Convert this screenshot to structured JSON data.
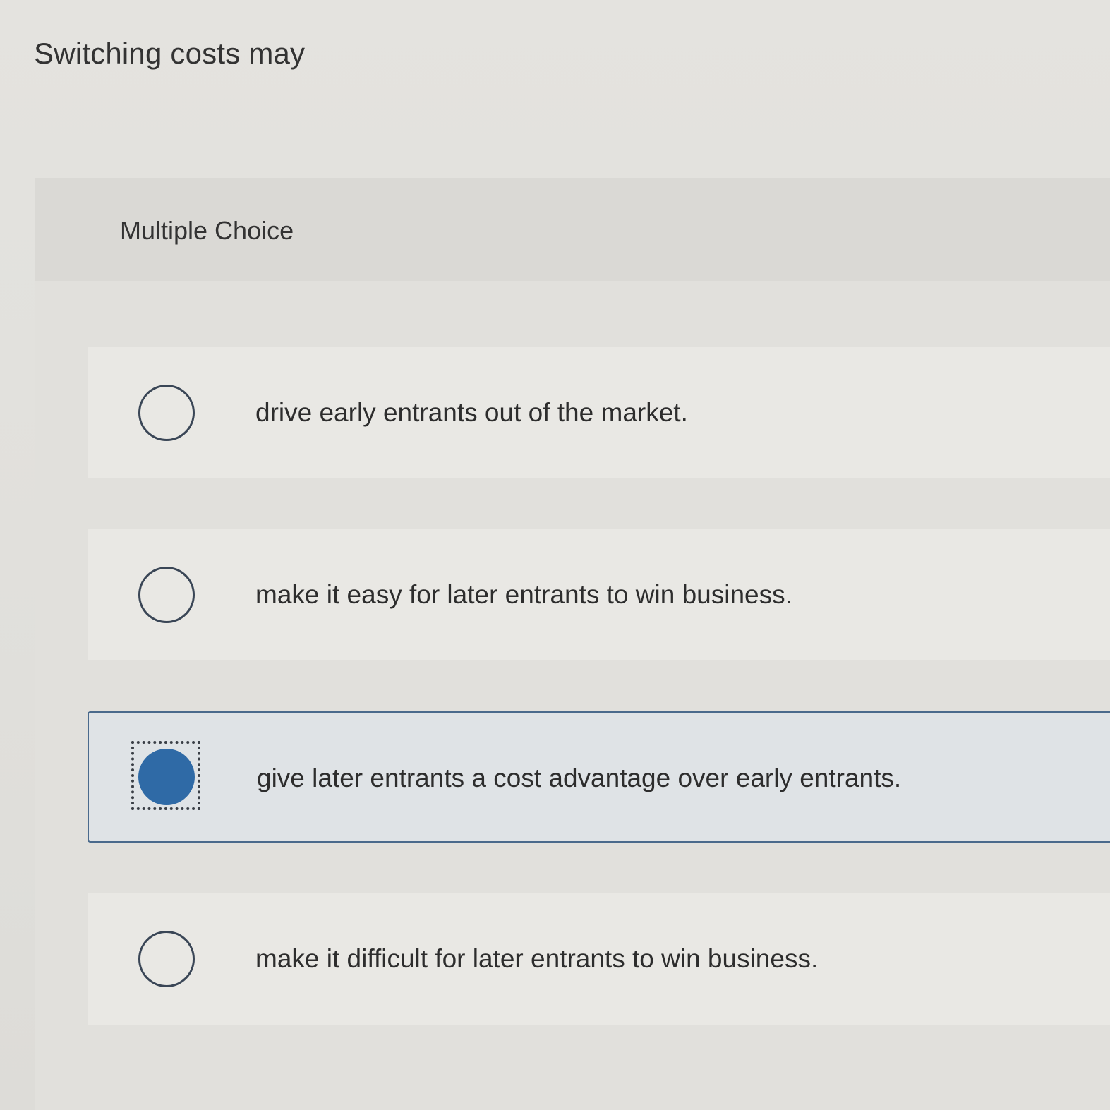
{
  "question": {
    "prompt": "Switching costs may",
    "type_label": "Multiple Choice"
  },
  "choices": [
    {
      "label": "drive early entrants out of the market.",
      "selected": false
    },
    {
      "label": "make it easy for later entrants to win business.",
      "selected": false
    },
    {
      "label": "give later entrants a cost advantage over early entrants.",
      "selected": true
    },
    {
      "label": "make it difficult for later entrants to win business.",
      "selected": false
    }
  ],
  "colors": {
    "selected_radio": "#2f6aa6",
    "selected_border": "#4a6a8c",
    "radio_outline": "#3a4656"
  },
  "icons": {
    "unselected": "radio-empty-circle",
    "selected": "radio-filled-circle"
  }
}
